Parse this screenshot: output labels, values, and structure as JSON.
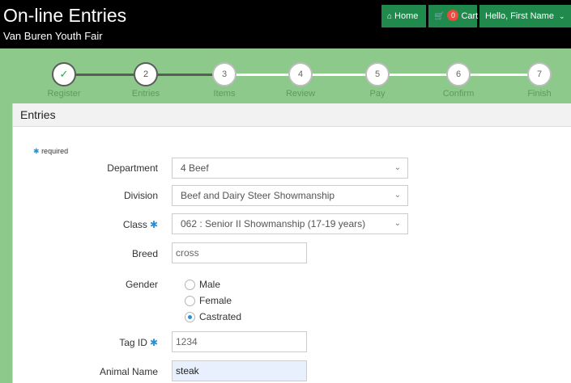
{
  "header": {
    "title": "On-line Entries",
    "subtitle": "Van Buren Youth Fair",
    "nav": {
      "home_label": "Home",
      "home_icon": "home-icon",
      "cart_label": "Cart",
      "cart_icon": "cart-icon",
      "cart_count": "0",
      "user_label": "Hello, First Name",
      "user_icon": "chevron-down-icon"
    }
  },
  "steps": [
    {
      "number": "✓",
      "label": "Register",
      "state": "done"
    },
    {
      "number": "2",
      "label": "Entries",
      "state": "active"
    },
    {
      "number": "3",
      "label": "Items",
      "state": "todo"
    },
    {
      "number": "4",
      "label": "Review",
      "state": "todo"
    },
    {
      "number": "5",
      "label": "Pay",
      "state": "todo"
    },
    {
      "number": "6",
      "label": "Confirm",
      "state": "todo"
    },
    {
      "number": "7",
      "label": "Finish",
      "state": "todo"
    }
  ],
  "panel": {
    "title": "Entries",
    "required_note": "required",
    "required_star": "✱"
  },
  "form": {
    "department": {
      "label": "Department",
      "value": "4 Beef"
    },
    "division": {
      "label": "Division",
      "value": "Beef and Dairy Steer Showmanship"
    },
    "class": {
      "label": "Class",
      "value": "062 : Senior II Showmanship (17-19 years)"
    },
    "breed": {
      "label": "Breed",
      "value": "cross"
    },
    "gender": {
      "label": "Gender",
      "options": [
        "Male",
        "Female",
        "Castrated"
      ],
      "selected": "Castrated"
    },
    "tag_id": {
      "label": "Tag ID",
      "value": "1234"
    },
    "animal_name": {
      "label": "Animal Name",
      "value": "steak"
    }
  },
  "colors": {
    "header_bg": "#000000",
    "nav_green": "#1f8a4c",
    "band_green": "#8cc98a",
    "accent_blue": "#2a8fd6",
    "badge_red": "#e74c3c"
  }
}
